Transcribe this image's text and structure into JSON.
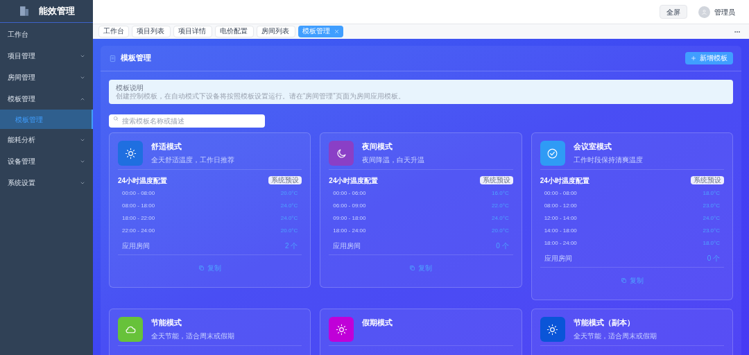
{
  "sidebar": {
    "title": "能效管理",
    "items": [
      {
        "label": "工作台",
        "kind": "link"
      },
      {
        "label": "项目管理",
        "kind": "group",
        "expanded": false
      },
      {
        "label": "房间管理",
        "kind": "group",
        "expanded": false
      },
      {
        "label": "模板管理",
        "kind": "group",
        "expanded": true,
        "children": [
          {
            "label": "模板管理",
            "selected": true
          }
        ]
      },
      {
        "label": "能耗分析",
        "kind": "group",
        "expanded": false
      },
      {
        "label": "设备管理",
        "kind": "group",
        "expanded": false
      },
      {
        "label": "系统设置",
        "kind": "group",
        "expanded": false
      }
    ]
  },
  "header": {
    "fullscreen_button": "全屏",
    "user": "管理员"
  },
  "tabs": [
    {
      "label": "工作台",
      "selected": false
    },
    {
      "label": "项目列表",
      "selected": false
    },
    {
      "label": "项目详情",
      "selected": false
    },
    {
      "label": "电价配置",
      "selected": false
    },
    {
      "label": "房间列表",
      "selected": false
    },
    {
      "label": "模板管理",
      "selected": true
    }
  ],
  "panel": {
    "title": "模板管理",
    "add_button": "新增模板",
    "notice": {
      "title": "模板说明",
      "text": "创建控制模板，在自动模式下设备将按照模板设置运行。请在“房间管理”页面为房间应用模板。"
    },
    "search": {
      "placeholder": "搜索模板名称或描述"
    },
    "cards": [
      {
        "name": "舒适模式",
        "description": "全天舒适温度，工作日推荐",
        "kind": "sun",
        "color": "#1f6fe0",
        "schedule_title": "24小时温度配置",
        "badge": "系统预设",
        "slots": [
          {
            "time": "00:00 - 08:00",
            "temp": "20.0°C"
          },
          {
            "time": "08:00 - 18:00",
            "temp": "24.0°C"
          },
          {
            "time": "18:00 - 22:00",
            "temp": "24.0°C"
          },
          {
            "time": "22:00 - 24:00",
            "temp": "20.0°C"
          }
        ],
        "rooms_label": "应用房间",
        "rooms_count": "2 个",
        "copy": "复制"
      },
      {
        "name": "夜间模式",
        "description": "夜间降温，白天升温",
        "kind": "moon",
        "color": "#8a3fc6",
        "schedule_title": "24小时温度配置",
        "badge": "系统预设",
        "slots": [
          {
            "time": "00:00 - 06:00",
            "temp": "16.0°C"
          },
          {
            "time": "06:00 - 09:00",
            "temp": "22.0°C"
          },
          {
            "time": "09:00 - 18:00",
            "temp": "24.0°C"
          },
          {
            "time": "18:00 - 24:00",
            "temp": "20.0°C"
          }
        ],
        "rooms_label": "应用房间",
        "rooms_count": "0 个",
        "copy": "复制"
      },
      {
        "name": "会议室模式",
        "description": "工作时段保持清爽温度",
        "kind": "check",
        "color": "#2f9bf5",
        "schedule_title": "24小时温度配置",
        "badge": "系统预设",
        "slots": [
          {
            "time": "00:00 - 08:00",
            "temp": "18.0°C"
          },
          {
            "time": "08:00 - 12:00",
            "temp": "23.0°C"
          },
          {
            "time": "12:00 - 14:00",
            "temp": "24.0°C"
          },
          {
            "time": "14:00 - 18:00",
            "temp": "23.0°C"
          },
          {
            "time": "18:00 - 24:00",
            "temp": "18.0°C"
          }
        ],
        "rooms_label": "应用房间",
        "rooms_count": "0 个",
        "copy": "复制"
      },
      {
        "name": "节能模式",
        "description": "全天节能，适合周末或假期",
        "kind": "cloud",
        "color": "#67c23a"
      },
      {
        "name": "假期模式",
        "kind": "sun",
        "color": "#c000d8"
      },
      {
        "name": "节能模式（副本）",
        "description": "全天节能，适合周末或假期",
        "kind": "sun",
        "color": "#0a55d8"
      }
    ]
  }
}
